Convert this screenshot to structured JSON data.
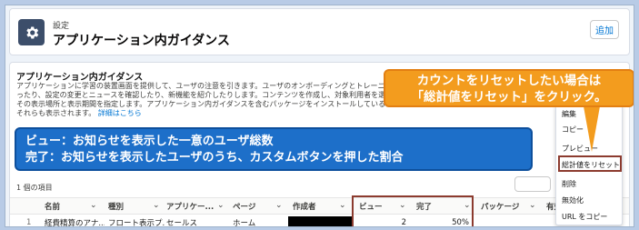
{
  "header": {
    "breadcrumb": "設定",
    "title": "アプリケーション内ガイダンス",
    "add_button": "追加"
  },
  "section": {
    "title": "アプリケーション内ガイダンス",
    "description_lines": [
      "アプリケーションに学習の装置画面を提供して、ユーザの注意を引きます。ユーザのオンボーディングとトレーニングを",
      "ったり、設定の変更とニュースを確認したり、新機能を紹介したりします。コンテンツを作成し、対象利用者を選択し",
      "その表示場所と表示期間を指定します。アプリケーション内ガイダンスを含むパッケージをインストールしている場合、",
      "それらも表示されます。"
    ],
    "link": "詳細はこちら",
    "item_count": "1 個の項目"
  },
  "table": {
    "columns": [
      "名前",
      "種別",
      "アプリケー...",
      "ページ",
      "作成者",
      "ビュー",
      "完了",
      "パッケージ",
      "有効"
    ],
    "rows": [
      {
        "num": "1",
        "name": "経費精算のアナ...",
        "type": "フロート表示プ...",
        "app": "セールス",
        "page": "ホーム",
        "views": "2",
        "completed": "50%"
      }
    ]
  },
  "menu": {
    "items": [
      "編集",
      "コピー",
      "プレビュー",
      "総計値をリセット",
      "削除",
      "無効化",
      "URL をコピー"
    ]
  },
  "callout": {
    "line1": "カウントをリセットしたい場合は",
    "line2": "「総計値をリセット」をクリック。"
  },
  "banner": {
    "line1": "ビュー：お知らせを表示した一意のユーザ総数",
    "line2": "完了：お知らせを表示したユーザのうち、カスタムボタンを押した割合"
  },
  "colors": {
    "accent": "#0176d3",
    "callout_orange": "#f39c1e",
    "banner_blue": "#1d6fc9",
    "highlight_red": "#8c3b2f"
  }
}
